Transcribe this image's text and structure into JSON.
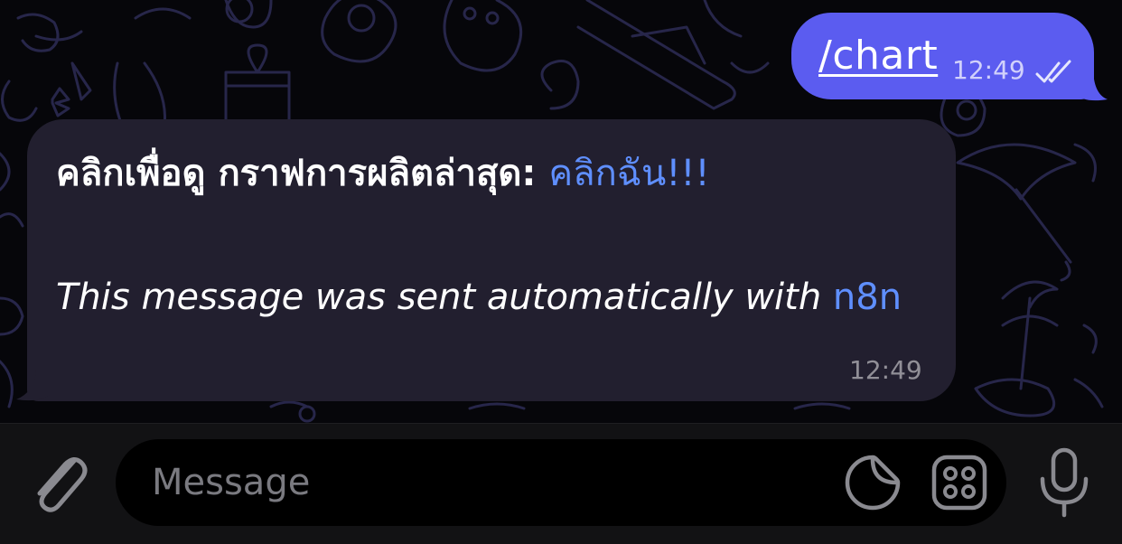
{
  "outgoing_message": {
    "text": "/chart",
    "time": "12:49",
    "bubble_color": "#5b5cf0",
    "status_icon": "double-check-icon"
  },
  "incoming_message": {
    "line1_text": "คลิกเพื่อดู กราฟการผลิตล่าสุด: ",
    "line1_link": "คลิกฉัน!!!",
    "italic_text": "This message was sent automatically with ",
    "italic_link": "n8n",
    "time": "12:49",
    "bubble_color": "#221f2f",
    "link_color": "#5f8fff"
  },
  "composer": {
    "placeholder": "Message",
    "attach_icon": "paperclip-icon",
    "sticker_icon": "sticker-icon",
    "emoji_icon": "emoji-grid-icon",
    "mic_icon": "microphone-icon"
  }
}
